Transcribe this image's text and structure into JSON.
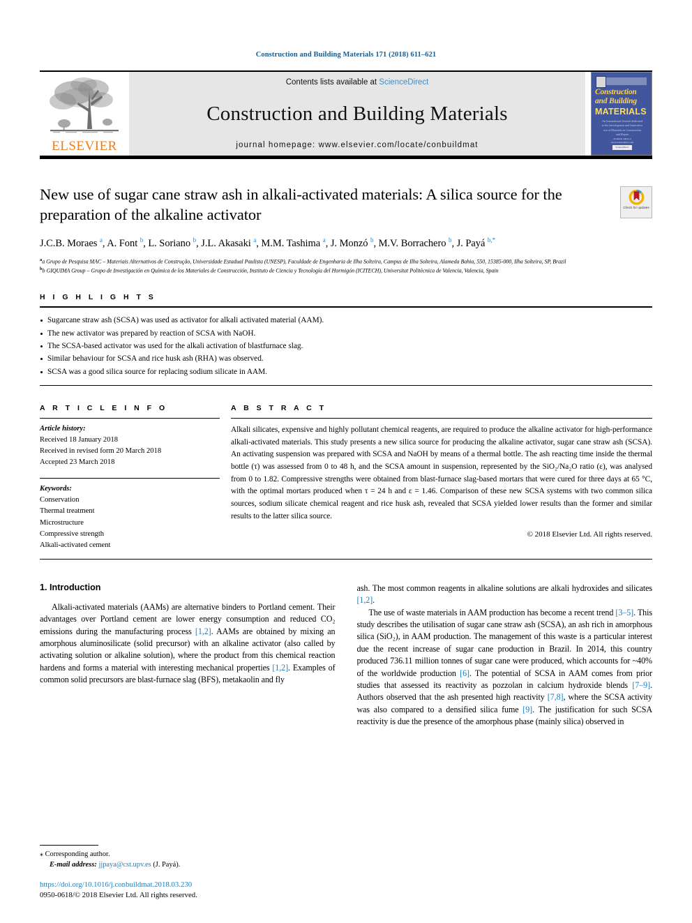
{
  "running_head": "Construction and Building Materials 171 (2018) 611–621",
  "masthead": {
    "publisher": "ELSEVIER",
    "contents_prefix": "Contents lists available at ",
    "contents_link": "ScienceDirect",
    "journal_title": "Construction and Building Materials",
    "homepage": "journal homepage: www.elsevier.com/locate/conbuildmat",
    "cover": {
      "line1": "Construction",
      "line2": "and Building",
      "line3": "MATERIALS",
      "blurb": "An International Journal dedicated to the Investigation and Innovative use of Materials in Construction and Repair",
      "foot": "Available online at www.sciencedirect.com",
      "foot_box": "ScienceDirect"
    }
  },
  "article": {
    "title": "New use of sugar cane straw ash in alkali-activated materials: A silica source for the preparation of the alkaline activator",
    "crossmark_label": "Check for updates",
    "authors_html": "J.C.B. Moraes <sup>a</sup>, A. Font <sup>b</sup>, L. Soriano <sup>b</sup>, J.L. Akasaki <sup>a</sup>, M.M. Tashima <sup>a</sup>, J. Monzó <sup>b</sup>, M.V. Borrachero <sup>b</sup>, J. Payá <sup>b,*</sup>",
    "affiliations": [
      "a Grupo de Pesquisa MAC – Materiais Alternativos de Construção, Universidade Estadual Paulista (UNESP), Faculdade de Engenharia de Ilha Solteira, Campus de Ilha Solteira, Alameda Bahia, 550, 15385-000, Ilha Solteira, SP, Brazil",
      "b GIQUIMA Group – Grupo de Investigación en Química de los Materiales de Construcción, Instituto de Ciencia y Tecnología del Hormigón (ICITECH), Universitat Politècnica de Valencia, Valencia, Spain"
    ]
  },
  "highlights": {
    "heading": "H I G H L I G H T S",
    "items": [
      "Sugarcane straw ash (SCSA) was used as activator for alkali activated material (AAM).",
      "The new activator was prepared by reaction of SCSA with NaOH.",
      "The SCSA-based activator was used for the alkali activation of blastfurnace slag.",
      "Similar behaviour for SCSA and rice husk ash (RHA) was observed.",
      "SCSA was a good silica source for replacing sodium silicate in AAM."
    ]
  },
  "article_info": {
    "heading": "A R T I C L E    I N F O",
    "history_label": "Article history:",
    "history": [
      "Received 18 January 2018",
      "Received in revised form 20 March 2018",
      "Accepted 23 March 2018"
    ],
    "keywords_label": "Keywords:",
    "keywords": [
      "Conservation",
      "Thermal treatment",
      "Microstructure",
      "Compressive strength",
      "Alkali-activated cement"
    ]
  },
  "abstract": {
    "heading": "A B S T R A C T",
    "text": "Alkali silicates, expensive and highly pollutant chemical reagents, are required to produce the alkaline activator for high-performance alkali-activated materials. This study presents a new silica source for producing the alkaline activator, sugar cane straw ash (SCSA). An activating suspension was prepared with SCSA and NaOH by means of a thermal bottle. The ash reacting time inside the thermal bottle (τ) was assessed from 0 to 48 h, and the SCSA amount in suspension, represented by the SiO₂/Na₂O ratio (ε), was analysed from 0 to 1.82. Compressive strengths were obtained from blast-furnace slag-based mortars that were cured for three days at 65 °C, with the optimal mortars produced when τ = 24 h and ε = 1.46. Comparison of these new SCSA systems with two common silica sources, sodium silicate chemical reagent and rice husk ash, revealed that SCSA yielded lower results than the former and similar results to the latter silica source.",
    "copyright": "© 2018 Elsevier Ltd. All rights reserved."
  },
  "body": {
    "section_title": "1. Introduction",
    "left_paragraphs": [
      "Alkali-activated materials (AAMs) are alternative binders to Portland cement. Their advantages over Portland cement are lower energy consumption and reduced CO₂ emissions during the manufacturing process [1,2]. AAMs are obtained by mixing an amorphous aluminosilicate (solid precursor) with an alkaline activator (also called by activating solution or alkaline solution), where the product from this chemical reaction hardens and forms a material with interesting mechanical properties [1,2]. Examples of common solid precursors are blast-furnace slag (BFS), metakaolin and fly"
    ],
    "right_paragraphs": [
      "ash. The most common reagents in alkaline solutions are alkali hydroxides and silicates [1,2].",
      "The use of waste materials in AAM production has become a recent trend [3–5]. This study describes the utilisation of sugar cane straw ash (SCSA), an ash rich in amorphous silica (SiO₂), in AAM production. The management of this waste is a particular interest due the recent increase of sugar cane production in Brazil. In 2014, this country produced 736.11 million tonnes of sugar cane were produced, which accounts for ~40% of the worldwide production [6]. The potential of SCSA in AAM comes from prior studies that assessed its reactivity as pozzolan in calcium hydroxide blends [7–9]. Authors observed that the ash presented high reactivity [7,8], where the SCSA activity was also compared to a densified silica fume [9]. The justification for such SCSA reactivity is due the presence of the amorphous phase (mainly silica) observed in"
    ]
  },
  "footer": {
    "corresponding_star": "⁎",
    "corresponding_label": "Corresponding author.",
    "email_label": "E-mail address:",
    "email": "jjpaya@cst.upv.es",
    "email_suffix": "(J. Payá).",
    "doi": "https://doi.org/10.1016/j.conbuildmat.2018.03.230",
    "issn_line": "0950-0618/© 2018 Elsevier Ltd. All rights reserved."
  },
  "colors": {
    "link_blue": "#1b7fbf",
    "header_blue": "#1b5c8e",
    "elsevier_orange": "#ef7d1a",
    "masthead_gray": "#e6e6e6",
    "cover_blue": "#41569c",
    "cover_yellow": "#ffd24a"
  }
}
